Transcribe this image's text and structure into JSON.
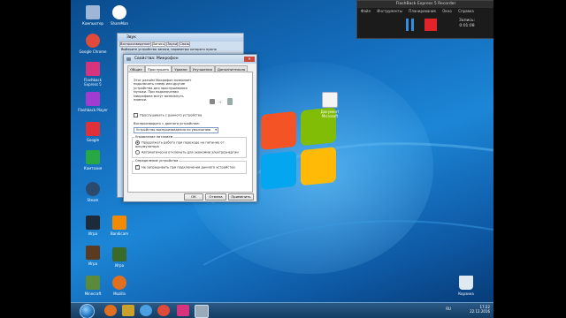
{
  "desktop_icons": [
    {
      "label": "Компьютер",
      "color": "#9fb7d6"
    },
    {
      "label": "ShareMan",
      "color": "#ffffff"
    },
    {
      "label": "Google Chrome",
      "color": "#e04a3a"
    },
    {
      "label": "Flashback Express 5",
      "color": "#d8347e"
    },
    {
      "label": "Flashback Player",
      "color": "#a23cd0"
    },
    {
      "label": "Google",
      "color": "#e0303a"
    },
    {
      "label": "Камтазия",
      "color": "#27a843"
    },
    {
      "label": "Steam",
      "color": "#2b4a6e"
    },
    {
      "label": "Игра",
      "color": "#1e2a3a"
    },
    {
      "label": "Bandicam",
      "color": "#f08a00"
    },
    {
      "label": "Игра",
      "color": "#5a3a20"
    },
    {
      "label": "Игра",
      "color": "#3a6a2a"
    },
    {
      "label": "Minecraft",
      "color": "#5a8a3a"
    },
    {
      "label": "Игра",
      "color": "#444444"
    },
    {
      "label": "Игра",
      "color": "#7a3a2a"
    },
    {
      "label": "Mozilla",
      "color": "#e07020"
    }
  ],
  "desktop_file_label": "Документ Microsoft",
  "recycle_bin_label": "Корзина",
  "flashback": {
    "title": "FlashBack Express 5 Recorder",
    "menu": [
      "Файл",
      "Инструменты",
      "Планирование",
      "Окно",
      "Справка"
    ],
    "rec_label": "Запись:",
    "rec_time": "0:01:08"
  },
  "back_window": {
    "title": "Звук",
    "tabs": [
      "Воспроизведение",
      "Запись",
      "Звуки",
      "Связь"
    ],
    "subtitle": "Выберите устройство записи, параметры которого нужно"
  },
  "dialog": {
    "title": "Свойства: Микрофон",
    "tabs": [
      "Общие",
      "Прослушать",
      "Уровни",
      "Улучшения",
      "Дополнительно"
    ],
    "description": "Этот разъём Микрофон позволяет подключать плеер или другие устройства для прослушивания музыки. При подключении микрофона могут возникнуть помехи.",
    "listen_checkbox": "Прослушивать с данного устройства",
    "playback_label": "Воспроизводить с данного устройства:",
    "playback_select": "Устройство воспроизведения по умолчанию",
    "power_group": "Управление питанием",
    "radio1": "Продолжать работу при переходе на питание от аккумулятора",
    "radio2": "Автоматически отключать для экономии электроэнергии",
    "detect_group": "Определение устройства",
    "detect_checkbox": "Не запрашивать при подключении данного устройства",
    "ok": "ОК",
    "cancel": "Отмена",
    "apply": "Применить"
  },
  "tray": {
    "lang": "RU",
    "time": "17:22",
    "date": "22.12.2016"
  }
}
